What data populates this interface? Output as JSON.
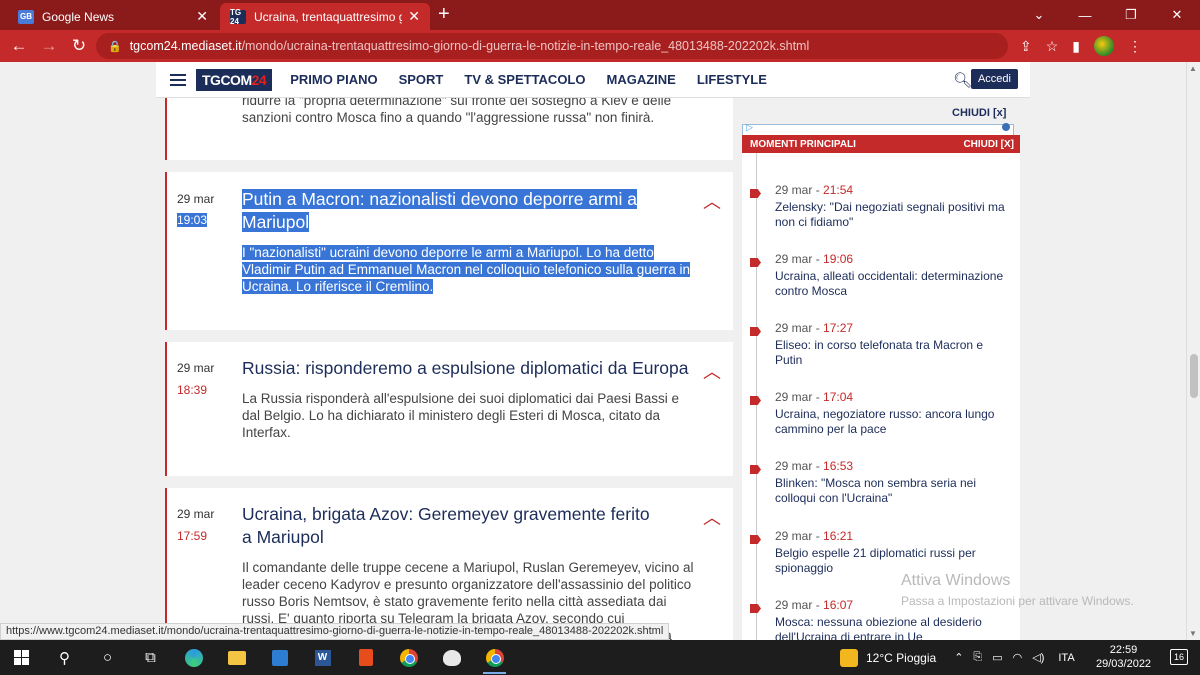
{
  "tabs": [
    {
      "title": "Google News",
      "favicon": "GB"
    },
    {
      "title": "Ucraina, trentaquattresimo giorno",
      "favicon": "TG 24"
    }
  ],
  "address": {
    "host": "tgcom24.mediaset.it",
    "path": "/mondo/ucraina-trentaquattresimo-giorno-di-guerra-le-notizie-in-tempo-reale_48013488-202202k.shtml"
  },
  "site": {
    "logo_main": "TGCOM",
    "logo_num": "24",
    "menu": [
      "PRIMO PIANO",
      "SPORT",
      "TV & SPETTACOLO",
      "MAGAZINE",
      "LIFESTYLE"
    ],
    "login_label": "Accedi"
  },
  "feed": {
    "partial_text": "ridurre la \"propria determinazione\" sul fronte del sostegno a Kiev e delle sanzioni contro Mosca fino a quando \"l'aggressione russa\" non finirà.",
    "cards": [
      {
        "date": "29 mar",
        "time": "19:03",
        "title": "Putin a Macron: nazionalisti devono deporre armi a Mariupol",
        "body": "I \"nazionalisti\" ucraini devono deporre le armi a Mariupol. Lo ha detto Vladimir Putin ad Emmanuel Macron nel colloquio telefonico sulla guerra in Ucraina. Lo riferisce il Cremlino."
      },
      {
        "date": "29 mar",
        "time": "18:39",
        "title": "Russia: risponderemo a espulsione diplomatici da Europa",
        "body": "La Russia risponderà all'espulsione dei suoi diplomatici dai Paesi Bassi e dal Belgio. Lo ha dichiarato il ministero degli Esteri di Mosca, citato da Interfax."
      },
      {
        "date": "29 mar",
        "time": "17:59",
        "title": "Ucraina, brigata Azov: Geremeyev gravemente ferito a Mariupol",
        "body": "Il comandante delle truppe cecene a Mariupol, Ruslan Geremeyev, vicino al leader ceceno Kadyrov e presunto organizzatore dell'assassinio del politico russo Boris Nemtsov, è stato gravemente ferito nella città assediata dai russi. E' quanto riporta su Telegram la brigata Azov, secondo cui \"Geremeyev è stato ferito in modo grave e ora è in gravi condizioni\", ma senza"
      }
    ]
  },
  "sidebar": {
    "close_label": "CHIUDI [x]",
    "momenti_label": "MOMENTI PRINCIPALI",
    "momenti_close": "CHIUDI [X]",
    "items": [
      {
        "date": "29 mar",
        "time": "21:54",
        "text": "Zelensky: \"Dai negoziati segnali positivi ma non ci fidiamo\""
      },
      {
        "date": "29 mar",
        "time": "19:06",
        "text": "Ucraina, alleati occidentali: determinazione contro Mosca"
      },
      {
        "date": "29 mar",
        "time": "17:27",
        "text": "Eliseo: in corso telefonata tra Macron e Putin"
      },
      {
        "date": "29 mar",
        "time": "17:04",
        "text": "Ucraina, negoziatore russo: ancora lungo cammino per la pace"
      },
      {
        "date": "29 mar",
        "time": "16:53",
        "text": "Blinken: \"Mosca non sembra seria nei colloqui con l'Ucraina\""
      },
      {
        "date": "29 mar",
        "time": "16:21",
        "text": "Belgio espelle 21 diplomatici russi per spionaggio"
      },
      {
        "date": "29 mar",
        "time": "16:07",
        "text": "Mosca: nessuna obiezione al desiderio dell'Ucraina di entrare in Ue"
      }
    ]
  },
  "watermark": {
    "title": "Attiva Windows",
    "subtitle": "Passa a Impostazioni per attivare Windows."
  },
  "status_url": "https://www.tgcom24.mediaset.it/mondo/ucraina-trentaquattresimo-giorno-di-guerra-le-notizie-in-tempo-reale_48013488-202202k.shtml",
  "taskbar": {
    "weather": "12°C  Pioggia",
    "lang": "ITA",
    "time": "22:59",
    "date": "29/03/2022",
    "notifications": "16"
  },
  "colors": {
    "brand_red": "#c42a2a",
    "navy": "#1d2d5a",
    "selection": "#3875d6"
  }
}
